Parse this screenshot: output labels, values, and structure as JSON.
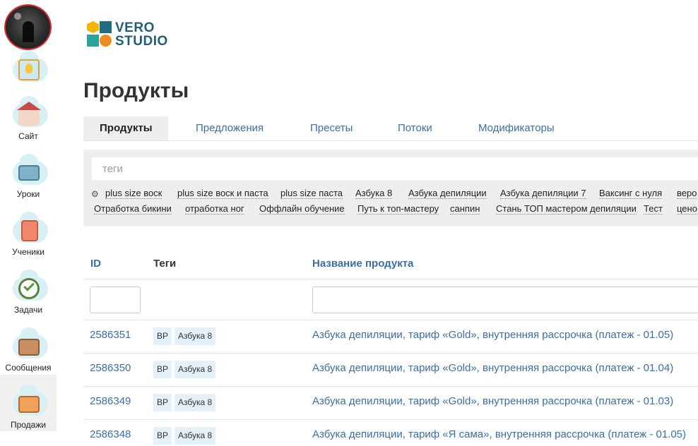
{
  "sidebar": {
    "items": [
      {
        "label": "",
        "icon": "idea-icon"
      },
      {
        "label": "Сайт",
        "icon": "house-icon"
      },
      {
        "label": "Уроки",
        "icon": "inbox-icon"
      },
      {
        "label": "Ученики",
        "icon": "notebook-icon"
      },
      {
        "label": "Задачи",
        "icon": "checkmark-icon"
      },
      {
        "label": "Сообщения",
        "icon": "mailbox-icon"
      },
      {
        "label": "Продажи",
        "icon": "briefcase-icon"
      }
    ]
  },
  "logo": {
    "line1": "VERO",
    "line2": "STUDIO"
  },
  "page_title": "Продукты",
  "tabs": [
    "Продукты",
    "Предложения",
    "Пресеты",
    "Потоки",
    "Модификаторы"
  ],
  "filter": {
    "placeholder": "теги",
    "row1": [
      "plus size воск",
      "plus size воск и паста",
      "plus size паста",
      "Азбука 8",
      "Азбука депиляции",
      "Азбука депиляции 7",
      "Ваксинг с нуля",
      "веро"
    ],
    "row2": [
      "Отработка бикини",
      "отработка ног",
      "Оффлайн обучение",
      "Путь к топ-мастеру",
      "санпин",
      "Стань ТОП мастером депиляции",
      "Тест",
      "цено"
    ]
  },
  "table": {
    "headers": {
      "id": "ID",
      "tags": "Теги",
      "name": "Название продукта"
    },
    "rows": [
      {
        "id": "2586351",
        "tags": [
          "ВР",
          "Азбука 8"
        ],
        "name": "Азбука депиляции, тариф «Gold», внутренняя рассрочка (платеж - 01.05)"
      },
      {
        "id": "2586350",
        "tags": [
          "ВР",
          "Азбука 8"
        ],
        "name": "Азбука депиляции, тариф «Gold», внутренняя рассрочка (платеж - 01.04)"
      },
      {
        "id": "2586349",
        "tags": [
          "ВР",
          "Азбука 8"
        ],
        "name": "Азбука депиляции, тариф «Gold», внутренняя рассрочка (платеж - 01.03)"
      },
      {
        "id": "2586348",
        "tags": [
          "ВР",
          "Азбука 8"
        ],
        "name": "Азбука депиляции, тариф «Я сама», внутренняя рассрочка (платеж - 01.05)"
      }
    ]
  },
  "colors": {
    "link": "#3a6ea5",
    "accent_red": "#d93030",
    "filter_bg": "#eeeeee",
    "tag_badge_bg": "#e4f1fb"
  }
}
